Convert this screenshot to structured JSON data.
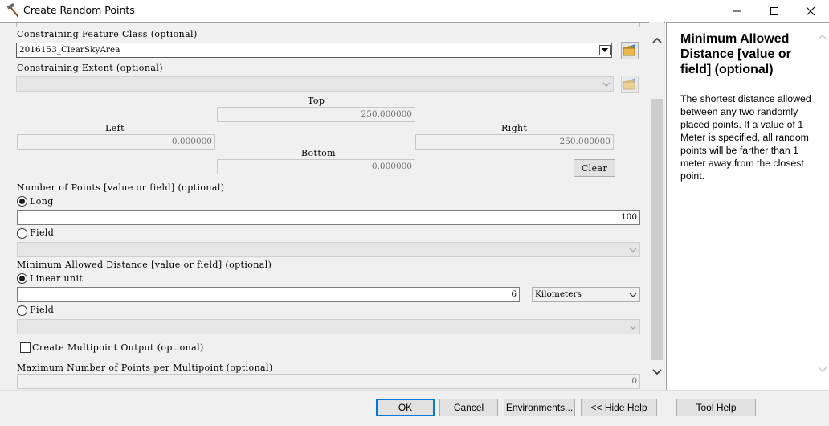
{
  "window": {
    "title": "Create Random Points",
    "icon": "hammer-icon"
  },
  "form": {
    "constraining_feature_class": {
      "label": "Constraining Feature Class (optional)",
      "value": "2016153_ClearSkyArea"
    },
    "constraining_extent": {
      "label": "Constraining Extent (optional)",
      "value": "",
      "top_label": "Top",
      "top_value": "250.000000",
      "left_label": "Left",
      "left_value": "0.000000",
      "right_label": "Right",
      "right_value": "250.000000",
      "bottom_label": "Bottom",
      "bottom_value": "0.000000",
      "clear_label": "Clear"
    },
    "number_of_points": {
      "label": "Number of Points [value or field] (optional)",
      "long_label": "Long",
      "long_value": "100",
      "long_selected": true,
      "field_label": "Field",
      "field_value": ""
    },
    "minimum_distance": {
      "label": "Minimum Allowed Distance [value or field] (optional)",
      "linear_label": "Linear unit",
      "linear_value": "6",
      "linear_selected": true,
      "unit": "Kilometers",
      "field_label": "Field",
      "field_value": ""
    },
    "multipoint": {
      "label": "Create Multipoint Output (optional)",
      "checked": false
    },
    "max_points_per_multipoint": {
      "label": "Maximum Number of Points per Multipoint (optional)",
      "value": "0"
    }
  },
  "help": {
    "title": "Minimum Allowed Distance [value or field] (optional)",
    "body": "The shortest distance allowed between any two randomly placed points. If a value of 1 Meter is specified, all random points will be farther than 1 meter away from the closest point."
  },
  "buttons": {
    "ok": "OK",
    "cancel": "Cancel",
    "environments": "Environments...",
    "hide_help": "<< Hide Help",
    "tool_help": "Tool Help"
  },
  "colors": {
    "accent": "#0078d7",
    "folder": "#e8b84a"
  }
}
